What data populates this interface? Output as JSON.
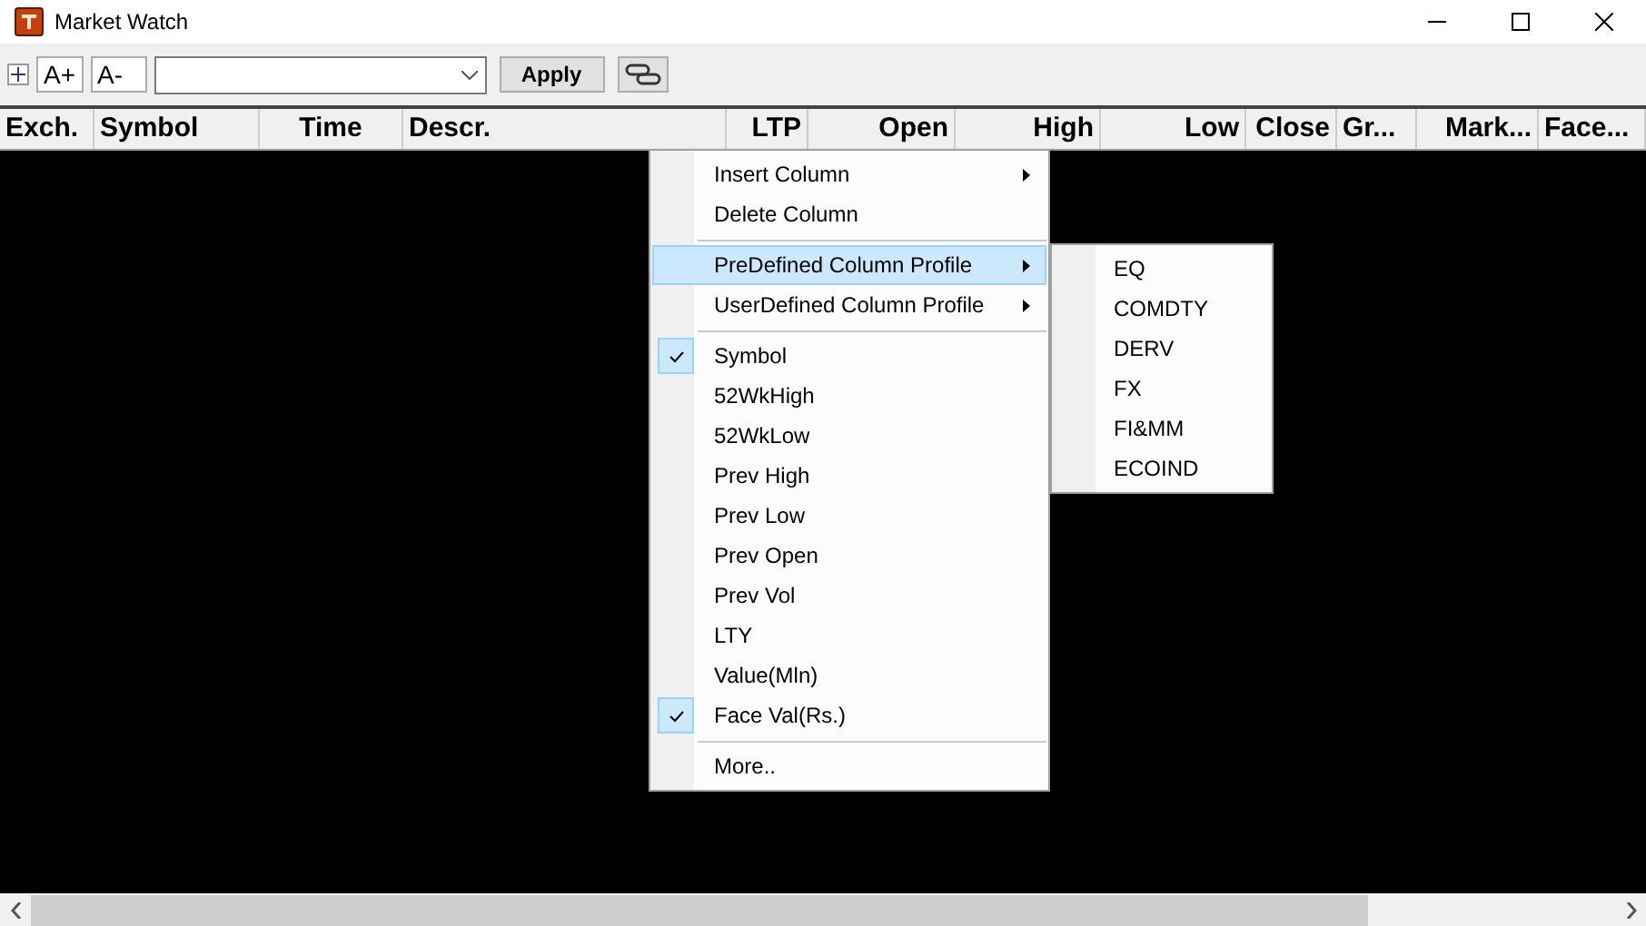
{
  "window": {
    "title": "Market Watch"
  },
  "toolbar": {
    "font_up": "A+",
    "font_down": "A-",
    "apply": "Apply"
  },
  "table": {
    "columns": [
      "Exch.",
      "Symbol",
      "Time",
      "Descr.",
      "LTP",
      "Open",
      "High",
      "Low",
      "Close",
      "Gr...",
      "Mark...",
      "Face..."
    ]
  },
  "context_menu": {
    "items": [
      {
        "kind": "submenu",
        "label": "Insert Column",
        "selected": false
      },
      {
        "kind": "command",
        "label": "Delete Column"
      },
      {
        "kind": "separator"
      },
      {
        "kind": "submenu",
        "label": "PreDefined Column Profile",
        "selected": true
      },
      {
        "kind": "submenu",
        "label": "UserDefined Column Profile",
        "selected": false
      },
      {
        "kind": "separator"
      },
      {
        "kind": "toggle",
        "label": "Symbol",
        "checked": true
      },
      {
        "kind": "toggle",
        "label": "52WkHigh",
        "checked": false
      },
      {
        "kind": "toggle",
        "label": "52WkLow",
        "checked": false
      },
      {
        "kind": "toggle",
        "label": "Prev High",
        "checked": false
      },
      {
        "kind": "toggle",
        "label": "Prev Low",
        "checked": false
      },
      {
        "kind": "toggle",
        "label": "Prev Open",
        "checked": false
      },
      {
        "kind": "toggle",
        "label": "Prev Vol",
        "checked": false
      },
      {
        "kind": "toggle",
        "label": "LTY",
        "checked": false
      },
      {
        "kind": "toggle",
        "label": "Value(Mln)",
        "checked": false
      },
      {
        "kind": "toggle",
        "label": "Face Val(Rs.)",
        "checked": true
      },
      {
        "kind": "separator"
      },
      {
        "kind": "command",
        "label": "More.."
      }
    ],
    "submenu": [
      "EQ",
      "COMDTY",
      "DERV",
      "FX",
      "FI&MM",
      "ECOIND"
    ]
  }
}
